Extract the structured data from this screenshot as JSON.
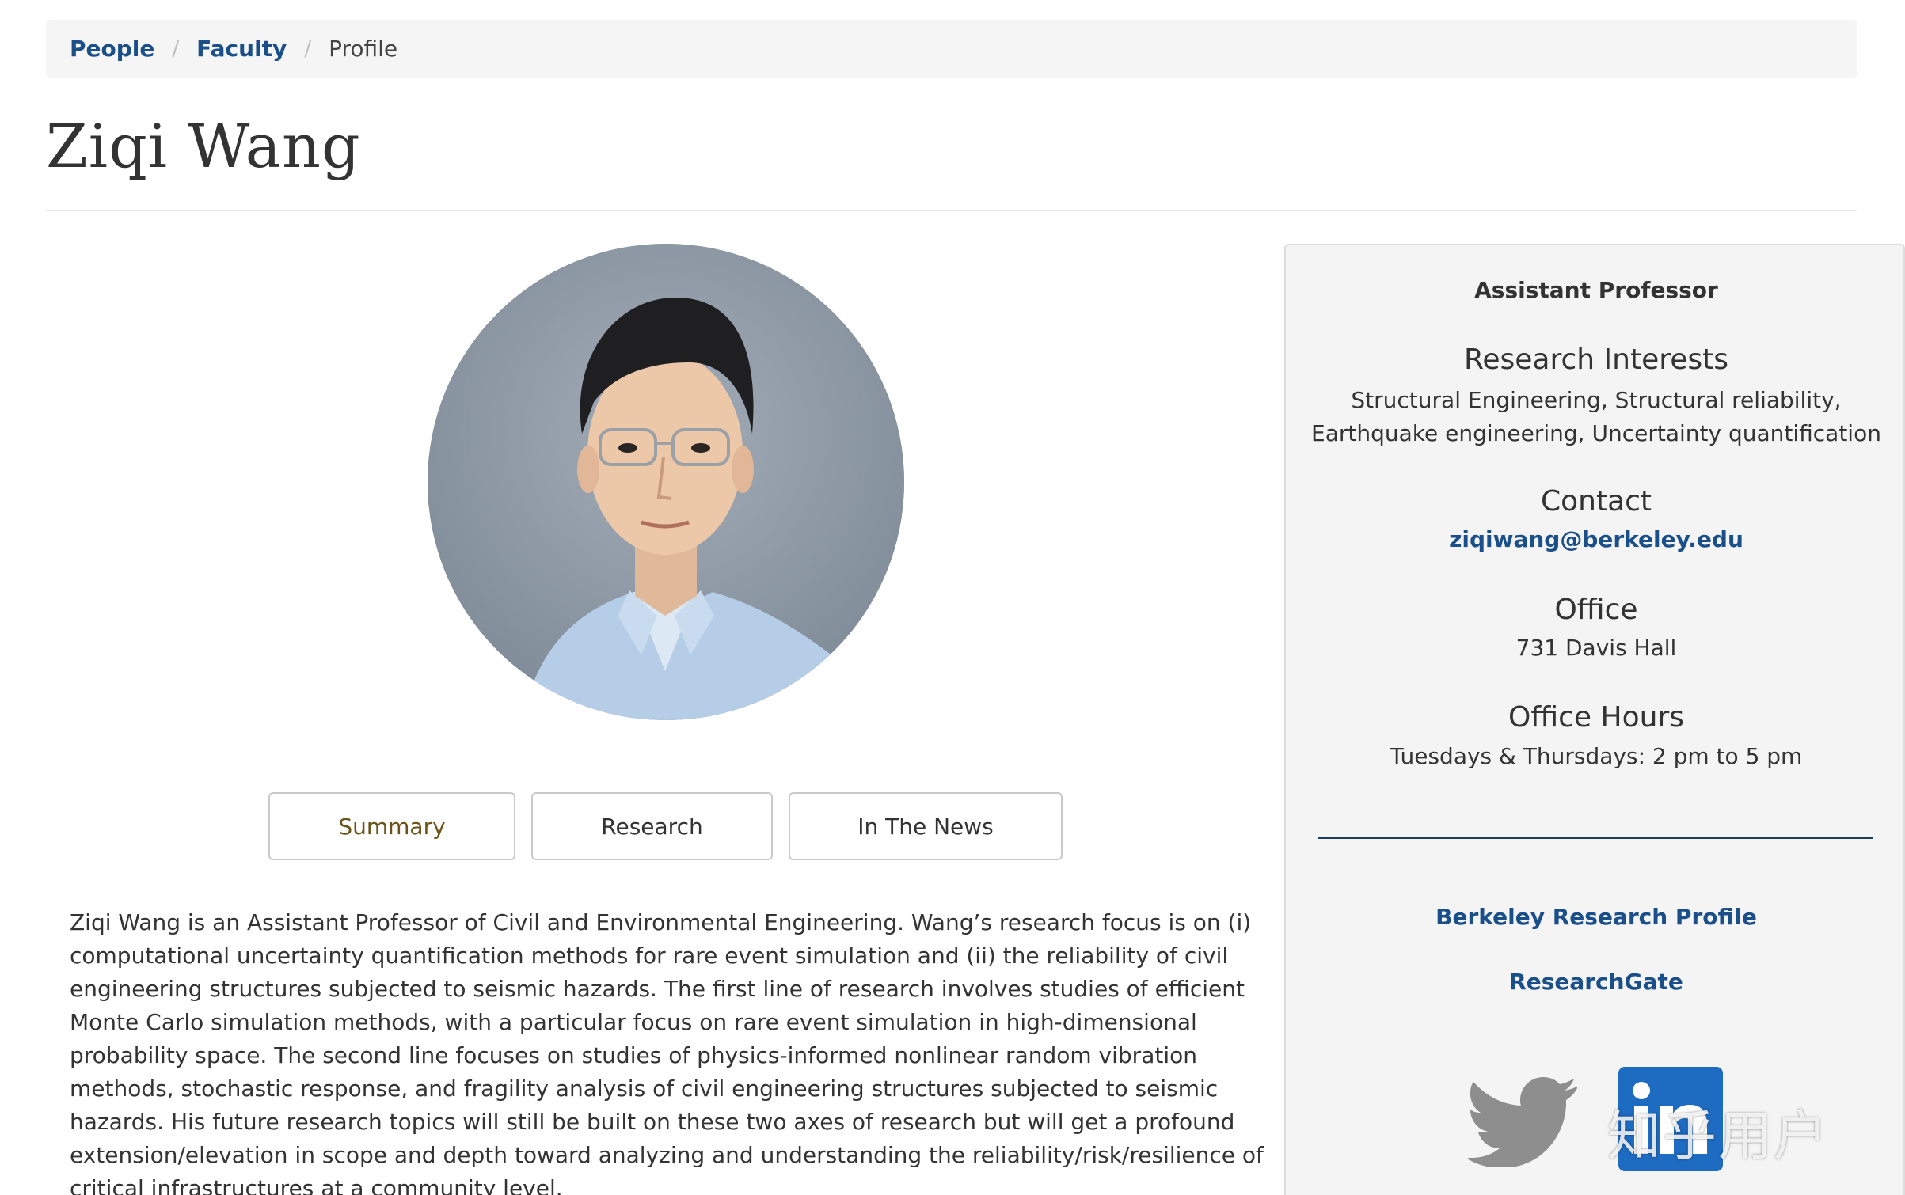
{
  "breadcrumb": {
    "items": [
      {
        "label": "People"
      },
      {
        "label": "Faculty"
      },
      {
        "label": "Profile"
      }
    ],
    "separator": "/"
  },
  "profile": {
    "name": "Ziqi Wang"
  },
  "tabs": [
    {
      "label": "Summary",
      "active": true
    },
    {
      "label": "Research",
      "active": false
    },
    {
      "label": "In The News",
      "active": false
    }
  ],
  "bio": "Ziqi Wang is an Assistant Professor of Civil and Environmental Engineering. Wang’s research focus is on (i) computational uncertainty quantification methods for rare event simulation and (ii) the reliability of civil engineering structures subjected to seismic hazards. The first line of research involves studies of efficient Monte Carlo simulation methods, with a particular focus on rare event simulation in high-dimensional probability space. The second line focuses on studies of physics-informed nonlinear random vibration methods, stochastic response, and fragility analysis of civil engineering structures subjected to seismic hazards. His future research topics will still be built on these two axes of research but will get a profound extension/elevation in scope and depth toward analyzing and understanding the reliability/risk/resilience of critical infrastructures at a community level.",
  "sidebar": {
    "role": "Assistant Professor",
    "research_heading": "Research Interests",
    "research_text": "Structural Engineering, Structural reliability, Earthquake engineering, Uncertainty quantification",
    "contact_heading": "Contact",
    "email": "ziqiwang@berkeley.edu",
    "office_heading": "Office",
    "office_text": "731 Davis Hall",
    "hours_heading": "Office Hours",
    "hours_text": "Tuesdays & Thursdays: 2 pm to 5 pm",
    "links": [
      {
        "label": "Berkeley Research Profile"
      },
      {
        "label": "ResearchGate"
      }
    ],
    "social": [
      {
        "icon": "twitter-icon"
      },
      {
        "icon": "linkedin-icon"
      }
    ]
  },
  "watermark": "知乎用户",
  "colors": {
    "link": "#1b4f8a",
    "active_tab_text": "#6b5317",
    "twitter_gray": "#8e8e8e",
    "linkedin_blue": "#1e6bc2"
  }
}
